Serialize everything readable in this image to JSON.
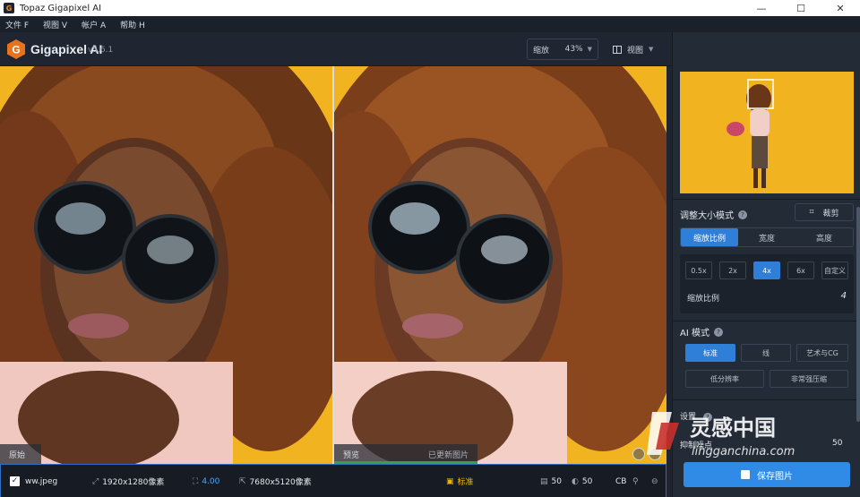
{
  "window": {
    "title": "Topaz Gigapixel AI",
    "minimize": "—",
    "maximize": "☐",
    "close": "✕"
  },
  "menu": [
    "文件 F",
    "视图 V",
    "帐户 A",
    "帮助 H"
  ],
  "header": {
    "app_name": "Gigapixel AI",
    "version": "v5.6.1",
    "zoom_label": "缩放",
    "zoom_value": "43%",
    "view_label": "视图"
  },
  "preview": {
    "original_label": "原始",
    "preview_label": "预览",
    "updated_label": "已更新图片",
    "progress": 1.0
  },
  "status": {
    "filename": "ww.jpeg",
    "source_size": "1920x1280像素",
    "scale": "4.00",
    "output_size": "7680x5120像素",
    "mode": "标准",
    "noise": "50",
    "blur": "50",
    "cb": "CB"
  },
  "panel": {
    "resize_title": "调整大小模式",
    "crop_label": "裁剪",
    "tabs": [
      "缩放比例",
      "宽度",
      "高度"
    ],
    "active_tab": 0,
    "scales": [
      "0.5x",
      "2x",
      "4x",
      "6x",
      "自定义"
    ],
    "active_scale": 2,
    "scale_label": "缩放比例",
    "scale_value": "4",
    "ai_title": "AI 模式",
    "modes_row1": [
      "标准",
      "线",
      "艺术与CG"
    ],
    "modes_row2": [
      "低分辨率",
      "非常强压缩"
    ],
    "active_mode": 0,
    "settings_title": "设置",
    "suppress_label": "抑制噪点",
    "suppress_value": "50",
    "save_label": "保存图片"
  },
  "watermark": {
    "brand": "灵感中国",
    "url": "lingganchina.com"
  },
  "colors": {
    "accent": "#2f7ed8",
    "background": "#f2b321",
    "progress": "#33a14e"
  }
}
